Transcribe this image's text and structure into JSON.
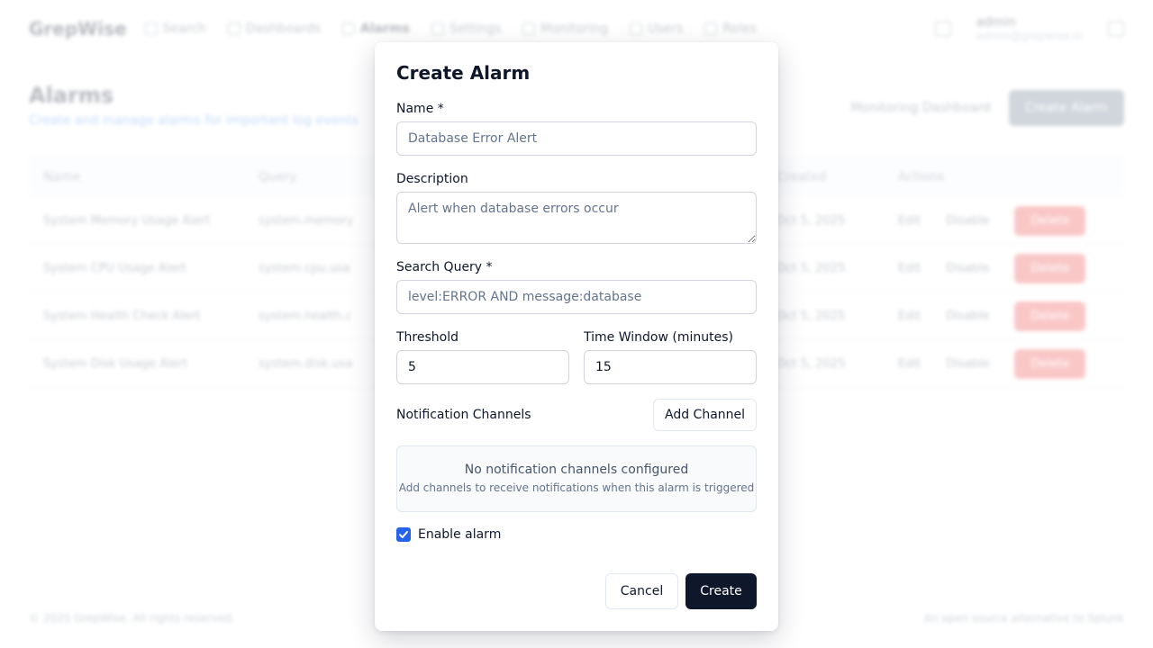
{
  "background": {
    "brand": "GrepWise",
    "nav": [
      {
        "label": "Search"
      },
      {
        "label": "Dashboards"
      },
      {
        "label": "Alarms"
      },
      {
        "label": "Settings"
      },
      {
        "label": "Monitoring"
      },
      {
        "label": "Users"
      },
      {
        "label": "Roles"
      }
    ],
    "user": {
      "name": "admin",
      "email": "admin@grepwise.io"
    },
    "page_title": "Alarms",
    "page_subtitle": "Create and manage alarms for important log events",
    "monitoring_link": "Monitoring Dashboard",
    "create_alarm_button": "Create Alarm",
    "table": {
      "columns": [
        "Name",
        "Query",
        "Created",
        "Actions"
      ],
      "rows": [
        {
          "name": "System Memory Usage Alert",
          "query": "system.memory",
          "created": "Oct 5, 2025",
          "edit": "Edit",
          "toggle": "Disable",
          "delete": "Delete"
        },
        {
          "name": "System CPU Usage Alert",
          "query": "system.cpu.usa",
          "created": "Oct 5, 2025",
          "edit": "Edit",
          "toggle": "Disable",
          "delete": "Delete"
        },
        {
          "name": "System Health Check Alert",
          "query": "system.health.c",
          "created": "Oct 5, 2025",
          "edit": "Edit",
          "toggle": "Disable",
          "delete": "Delete"
        },
        {
          "name": "System Disk Usage Alert",
          "query": "system.disk.usa",
          "created": "Oct 5, 2025",
          "edit": "Edit",
          "toggle": "Disable",
          "delete": "Delete"
        }
      ]
    },
    "footer_left": "© 2025 GrepWise. All rights reserved.",
    "footer_right": "An open source alternative to Splunk"
  },
  "modal": {
    "title": "Create Alarm",
    "name_label": "Name *",
    "name_placeholder": "Database Error Alert",
    "description_label": "Description",
    "description_placeholder": "Alert when database errors occur",
    "query_label": "Search Query *",
    "query_placeholder": "level:ERROR AND message:database",
    "threshold_label": "Threshold",
    "threshold_value": "5",
    "window_label": "Time Window (minutes)",
    "window_value": "15",
    "channels_label": "Notification Channels",
    "add_channel_button": "Add Channel",
    "empty_title": "No notification channels configured",
    "empty_subtitle": "Add channels to receive notifications when this alarm is triggered",
    "enable_label": "Enable alarm",
    "enable_checked": true,
    "cancel_button": "Cancel",
    "create_button": "Create"
  },
  "colors": {
    "primary_dark": "#0f172a",
    "checkbox_accent": "#2563eb",
    "danger": "#ef4444"
  }
}
